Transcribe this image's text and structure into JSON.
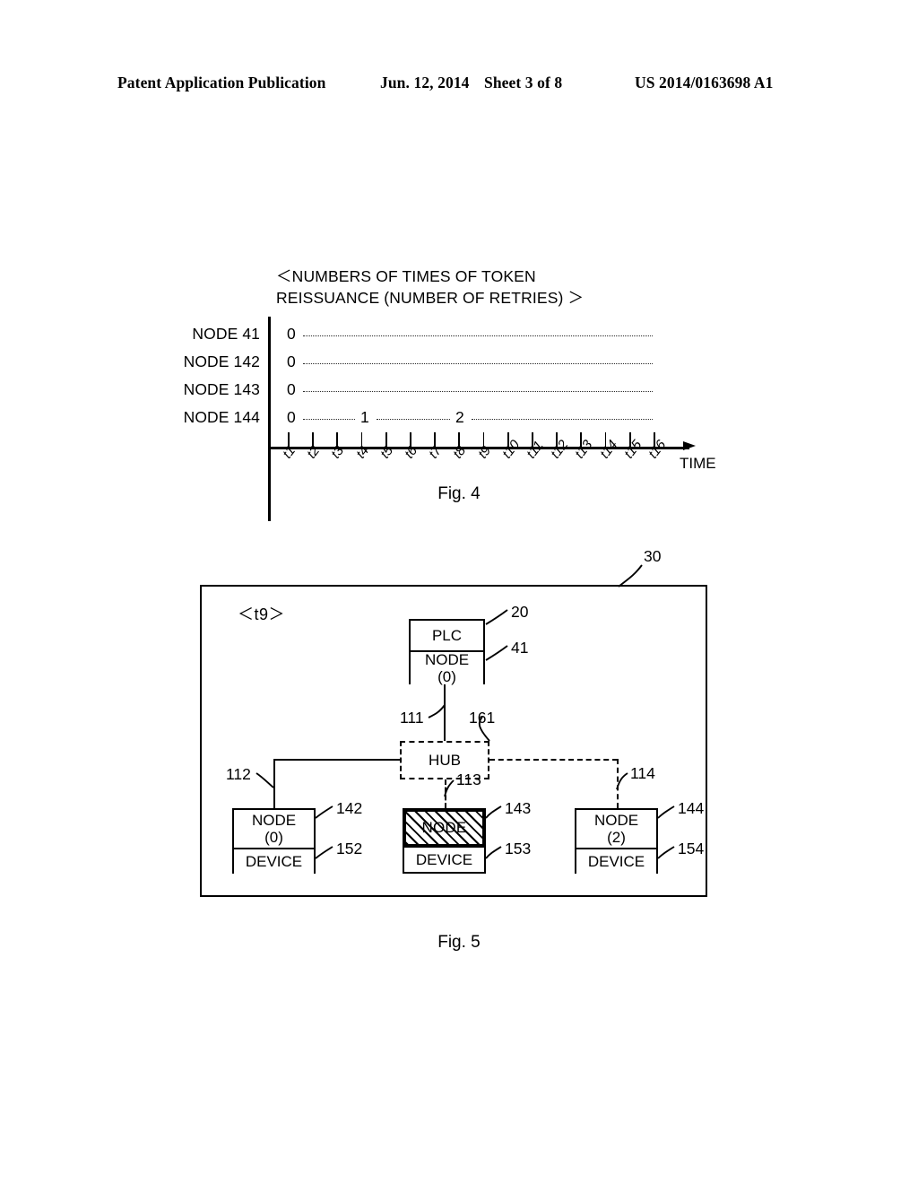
{
  "header": {
    "publication": "Patent Application Publication",
    "date": "Jun. 12, 2014",
    "sheet": "Sheet 3 of 8",
    "patent_number": "US 2014/0163698 A1"
  },
  "fig4": {
    "caption": "Fig. 4",
    "title": "＜NUMBERS OF TIMES OF TOKEN\n   REISSUANCE (NUMBER OF RETRIES) ＞",
    "time_axis_label": "TIME",
    "row_labels": [
      "NODE 41",
      "NODE 142",
      "NODE 143",
      "NODE 144"
    ],
    "tick_labels": [
      "t1",
      "t2",
      "t3",
      "t4",
      "t5",
      "t6",
      "t7",
      "t8",
      "t9",
      "t10",
      "t11",
      "t12",
      "t13",
      "t14",
      "t15",
      "t16"
    ],
    "rows": [
      {
        "label": "NODE 41",
        "values": [
          "0"
        ]
      },
      {
        "label": "NODE 142",
        "values": [
          "0"
        ]
      },
      {
        "label": "NODE 143",
        "values": [
          "0"
        ]
      },
      {
        "label": "NODE 144",
        "values": [
          "0",
          "1",
          "2"
        ]
      }
    ]
  },
  "chart_data": {
    "type": "line",
    "title": "＜NUMBERS OF TIMES OF TOKEN REISSUANCE (NUMBER OF RETRIES) ＞",
    "xlabel": "TIME",
    "ylabel": "",
    "x": [
      "t1",
      "t2",
      "t3",
      "t4",
      "t5",
      "t6",
      "t7",
      "t8",
      "t9",
      "t10",
      "t11",
      "t12",
      "t13",
      "t14",
      "t15",
      "t16"
    ],
    "series": [
      {
        "name": "NODE 41",
        "values": [
          0,
          0,
          0,
          0,
          0,
          0,
          0,
          0,
          0,
          0,
          0,
          0,
          0,
          0,
          0,
          0
        ]
      },
      {
        "name": "NODE 142",
        "values": [
          0,
          0,
          0,
          0,
          0,
          0,
          0,
          0,
          0,
          0,
          0,
          0,
          0,
          0,
          0,
          0
        ]
      },
      {
        "name": "NODE 143",
        "values": [
          0,
          0,
          0,
          0,
          0,
          0,
          0,
          0,
          0,
          0,
          0,
          0,
          0,
          0,
          0,
          0
        ]
      },
      {
        "name": "NODE 144",
        "values": [
          0,
          0,
          0,
          1,
          1,
          1,
          1,
          2,
          2,
          2,
          2,
          2,
          2,
          2,
          2,
          2
        ]
      }
    ],
    "grid": false,
    "legend": "none"
  },
  "fig5": {
    "caption": "Fig. 5",
    "time_marker": "＜t9＞",
    "system_ref": "30",
    "plc": {
      "title": "PLC",
      "title_ref": "20",
      "node_line1": "NODE",
      "node_line2": "(0)",
      "node_ref": "41"
    },
    "hub": {
      "label": "HUB",
      "ref": "161"
    },
    "links": [
      {
        "ref": "111",
        "style": "solid"
      },
      {
        "ref": "112",
        "style": "solid"
      },
      {
        "ref": "113",
        "style": "dashed"
      },
      {
        "ref": "114",
        "style": "dashed"
      }
    ],
    "nodes": [
      {
        "node_line1": "NODE",
        "node_line2": "(0)",
        "node_ref": "142",
        "device_label": "DEVICE",
        "device_ref": "152",
        "highlighted": false
      },
      {
        "node_line1": "NODE",
        "node_line2": "",
        "node_ref": "143",
        "device_label": "DEVICE",
        "device_ref": "153",
        "highlighted": true
      },
      {
        "node_line1": "NODE",
        "node_line2": "(2)",
        "node_ref": "144",
        "device_label": "DEVICE",
        "device_ref": "154",
        "highlighted": false
      }
    ]
  }
}
